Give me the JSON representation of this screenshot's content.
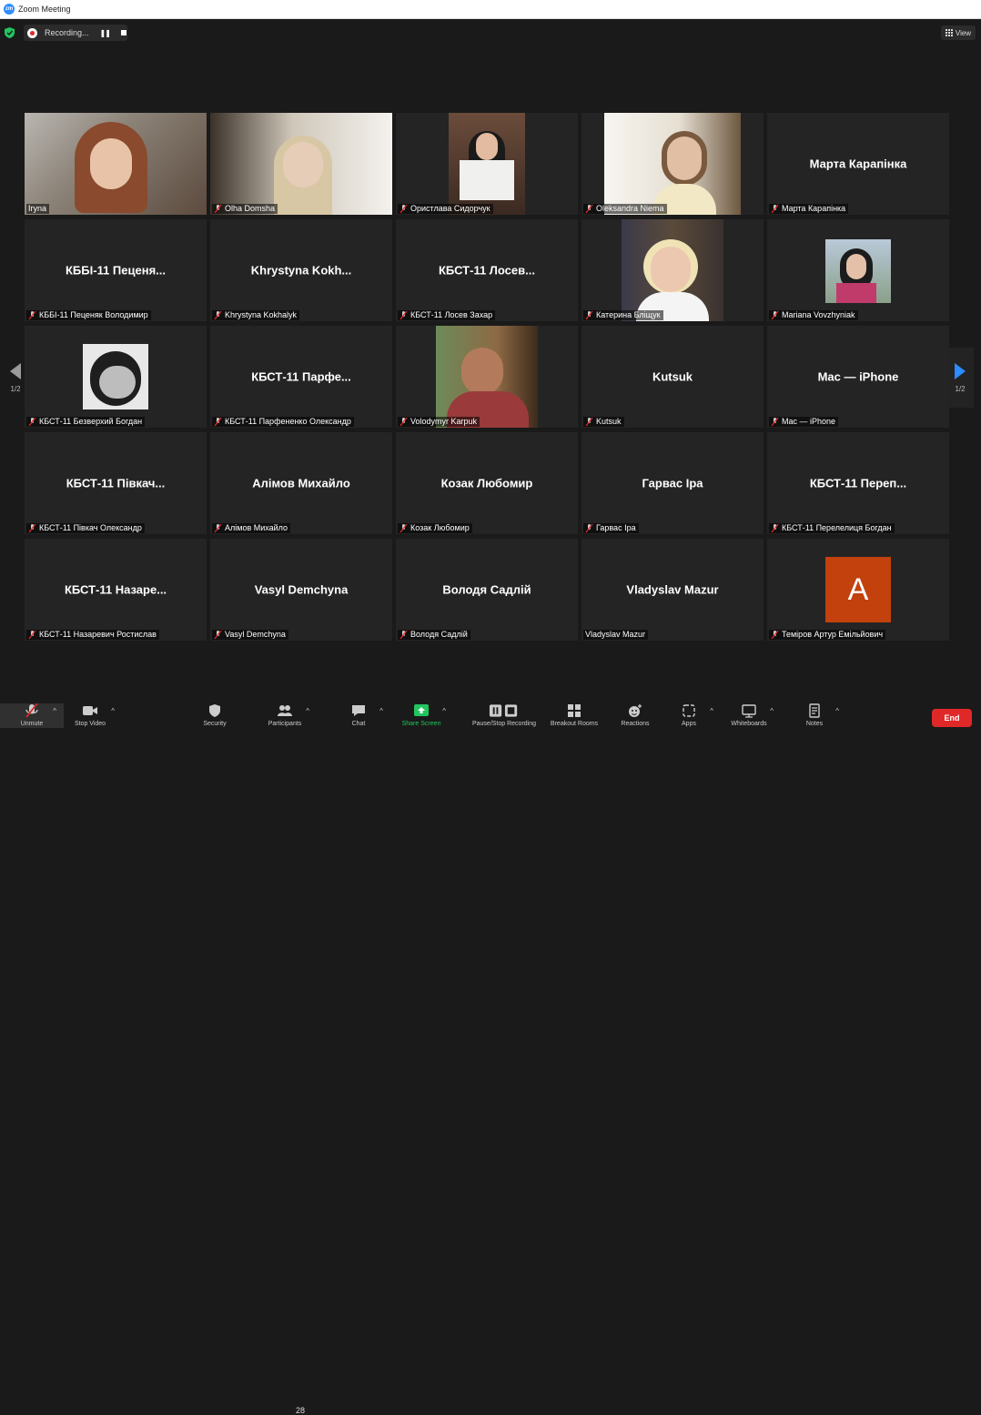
{
  "window": {
    "title": "Zoom Meeting"
  },
  "recording": {
    "label": "Recording...",
    "pause_glyph": "❚❚"
  },
  "view_button": {
    "label": "View"
  },
  "pager": {
    "label": "1/2"
  },
  "tiles": [
    {
      "display": "",
      "label": "Iryna",
      "muted": false
    },
    {
      "display": "",
      "label": "Olha Domsha",
      "muted": true
    },
    {
      "display": "",
      "label": "Ористлава Сидорчук",
      "muted": true
    },
    {
      "display": "",
      "label": "Oleksandra Niema",
      "muted": true
    },
    {
      "display": "Марта Карапінка",
      "label": "Марта Карапінка",
      "muted": true
    },
    {
      "display": "КББІ-11 Пеценя...",
      "label": "КББІ-11 Пеценяк Володимир",
      "muted": true
    },
    {
      "display": "Khrystyna  Kokh...",
      "label": "Khrystyna Kokhalyk",
      "muted": true
    },
    {
      "display": "КБСТ-11  Лосев...",
      "label": "КБСТ-11 Лосев Захар",
      "muted": true
    },
    {
      "display": "",
      "label": "Катерина Бліщук",
      "muted": true
    },
    {
      "display": "",
      "label": "Mariana Vovzhyniak",
      "muted": true
    },
    {
      "display": "",
      "label": "КБСТ-11 Безверхий Богдан",
      "muted": true
    },
    {
      "display": "КБСТ-11  Парфе...",
      "label": "КБСТ-11 Парфененко Олександр",
      "muted": true
    },
    {
      "display": "",
      "label": "Volodymyr Karpuk",
      "muted": true
    },
    {
      "display": "Kutsuk",
      "label": "Kutsuk",
      "muted": true
    },
    {
      "display": "Mac — iPhone",
      "label": "Mac — iPhone",
      "muted": true
    },
    {
      "display": "КБСТ-11  Півкач...",
      "label": "КБСТ-11 Півкач Олександр",
      "muted": true
    },
    {
      "display": "Алімов Михайло",
      "label": "Алімов Михайло",
      "muted": true
    },
    {
      "display": "Козак Любомир",
      "label": "Козак Любомир",
      "muted": true
    },
    {
      "display": "Гарвас Іра",
      "label": "Гарвас Іра",
      "muted": true
    },
    {
      "display": "КБСТ-11  Переп...",
      "label": "КБСТ-11 Перелелиця Богдан",
      "muted": true
    },
    {
      "display": "КБСТ-11  Назаре...",
      "label": "КБСТ-11 Назаревич Ростислав",
      "muted": true
    },
    {
      "display": "Vasyl Demchyna",
      "label": "Vasyl Demchyna",
      "muted": true
    },
    {
      "display": "Володя Садлій",
      "label": "Володя Садлій",
      "muted": true
    },
    {
      "display": "Vladyslav Mazur",
      "label": "Vladyslav Mazur",
      "muted": false
    },
    {
      "display": "",
      "label": "Теміров Артур Емільйович",
      "muted": true,
      "avatar_letter": "A"
    }
  ],
  "toolbar": {
    "unmute": "Unmute",
    "stop_video": "Stop Video",
    "security": "Security",
    "participants": "Participants",
    "participants_count": "28",
    "chat": "Chat",
    "share_screen": "Share Screen",
    "pause_share": "Pause/Stop Recording",
    "breakout": "Breakout Rooms",
    "reactions": "Reactions",
    "apps": "Apps",
    "whiteboards": "Whiteboards",
    "notes": "Notes",
    "end": "End"
  },
  "colors": {
    "active_speaker": "#c8e85a",
    "end": "#e02828",
    "share": "#22c55e",
    "avatar_bg": "#c2410c",
    "accent": "#2d8cff"
  }
}
